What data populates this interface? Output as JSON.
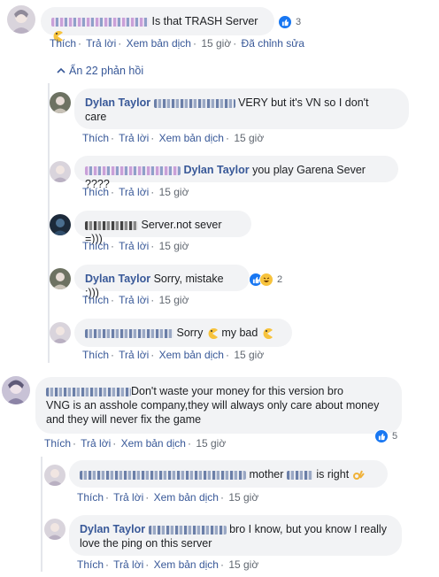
{
  "actions": {
    "like": "Thích",
    "reply": "Trả lời",
    "translate": "Xem bản dịch",
    "edited": "Đã chỉnh sửa",
    "sep": "·"
  },
  "comments": {
    "c1": {
      "text": "Is that TRASH Server",
      "reactions": "3",
      "time": "15 giờ"
    },
    "hide_replies": "Ẩn 22 phản hồi",
    "r1": {
      "name": "Dylan Taylor",
      "text_a": "VERY but it's VN so I don't",
      "text_b": "care",
      "time": "15 giờ"
    },
    "r2": {
      "name": "Dylan Taylor",
      "text": "you play Garena Sever ????",
      "time": "15 giờ"
    },
    "r3": {
      "text": "Server.not sever =)))",
      "time": "15 giờ"
    },
    "r4": {
      "name": "Dylan Taylor",
      "text": "Sorry, mistake :)))",
      "reactions": "2",
      "time": "15 giờ"
    },
    "r5": {
      "text_a": "Sorry",
      "text_b": "my bad",
      "time": "15 giờ"
    },
    "c2": {
      "line1": "Don't waste your money for this version bro",
      "line2": "VNG is an asshole company,they will always only care about money",
      "line3": "and they will never fix the game",
      "reactions": "5",
      "time": "15 giờ"
    },
    "r6": {
      "text_a": "mother",
      "text_b": "is right",
      "time": "15 giờ"
    },
    "r7": {
      "name": "Dylan Taylor",
      "line1": "bro I know, but you know I really",
      "line2": "love the ping on this server",
      "time": "15 giờ"
    }
  },
  "colors": {
    "link": "#385898",
    "bubble": "#f2f3f5",
    "meta": "#606770",
    "like": "#1877f2"
  }
}
